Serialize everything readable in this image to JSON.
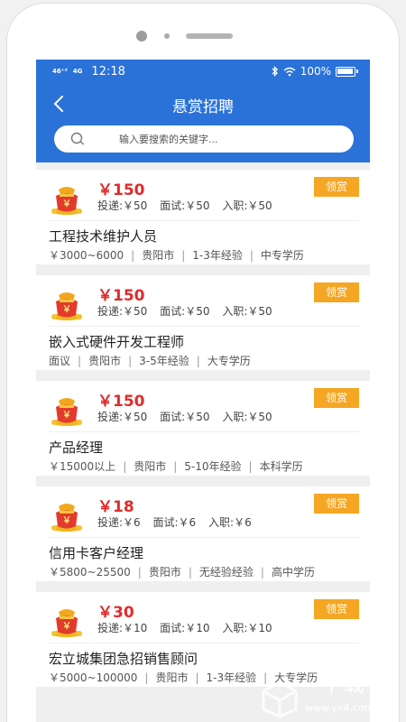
{
  "statusbar": {
    "signal1": "46⁺ᵈ",
    "signal2": "4G",
    "time": "12:18",
    "battery_text": "100%",
    "battery_level": 1.0
  },
  "header": {
    "title": "悬赏招聘",
    "search_placeholder": "输入要搜索的关键字..."
  },
  "colors": {
    "header_bg": "#2a72d8",
    "reward_red": "#e02b2b",
    "claim_orange": "#f5a623"
  },
  "jobs": [
    {
      "reward": "￥150",
      "send": "投递:￥50",
      "interview": "面试:￥50",
      "hire": "入职:￥50",
      "claim": "领赏",
      "title": "工程技术维护人员",
      "salary": "￥3000~6000",
      "city": "贵阳市",
      "experience": "1-3年经验",
      "education": "中专学历"
    },
    {
      "reward": "￥150",
      "send": "投递:￥50",
      "interview": "面试:￥50",
      "hire": "入职:￥50",
      "claim": "领赏",
      "title": "嵌入式硬件开发工程师",
      "salary": "面议",
      "city": "贵阳市",
      "experience": "3-5年经验",
      "education": "大专学历"
    },
    {
      "reward": "￥150",
      "send": "投递:￥50",
      "interview": "面试:￥50",
      "hire": "入职:￥50",
      "claim": "领赏",
      "title": "产品经理",
      "salary": "￥15000以上",
      "city": "贵阳市",
      "experience": "5-10年经验",
      "education": "本科学历"
    },
    {
      "reward": "￥18",
      "send": "投递:￥6",
      "interview": "面试:￥6",
      "hire": "入职:￥6",
      "claim": "领赏",
      "title": "信用卡客户经理",
      "salary": "￥5800~25500",
      "city": "贵阳市",
      "experience": "无经验经验",
      "education": "高中学历"
    },
    {
      "reward": "￥30",
      "send": "投递:￥10",
      "interview": "面试:￥10",
      "hire": "入职:￥10",
      "claim": "领赏",
      "title": "宏立城集团急招销售顾问",
      "salary": "￥5000~100000",
      "city": "贵阳市",
      "experience": "1-3年经验",
      "education": "大专学历"
    }
  ],
  "watermark": {
    "text": "下载",
    "url": "www.yx4.com"
  }
}
